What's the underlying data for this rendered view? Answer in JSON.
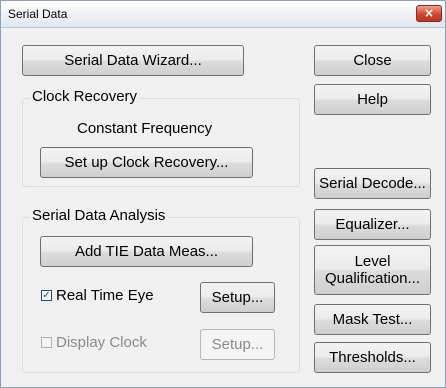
{
  "window": {
    "title": "Serial Data",
    "close_glyph": "×"
  },
  "main": {
    "wizard_button": "Serial Data Wizard...",
    "clock_recovery": {
      "title": "Clock Recovery",
      "mode": "Constant Frequency",
      "setup_button": "Set up Clock Recovery..."
    },
    "analysis": {
      "title": "Serial Data Analysis",
      "add_tie_button": "Add TIE Data Meas...",
      "real_time_eye": {
        "label": "Real Time Eye",
        "checked": true,
        "check_glyph": "✓",
        "setup_button": "Setup..."
      },
      "display_clock": {
        "label": "Display Clock",
        "checked": false,
        "enabled": false,
        "setup_button": "Setup..."
      }
    }
  },
  "side": {
    "close": "Close",
    "help": "Help",
    "serial_decode": "Serial Decode...",
    "equalizer": "Equalizer...",
    "level_qualification": "Level\nQualification...",
    "mask_test": "Mask Test...",
    "thresholds": "Thresholds..."
  }
}
